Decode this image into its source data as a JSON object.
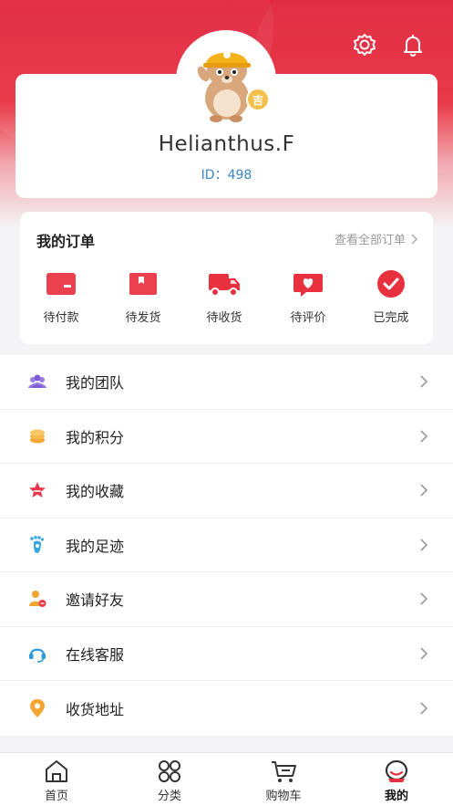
{
  "profile": {
    "username": "Helianthus.F",
    "user_id": "ID：498",
    "badge": "吉"
  },
  "header_icons": [
    "settings-icon",
    "bell-icon"
  ],
  "orders": {
    "title": "我的订单",
    "view_all": "查看全部订单",
    "items": [
      {
        "label": "待付款",
        "icon": "wallet-icon"
      },
      {
        "label": "待发货",
        "icon": "package-icon"
      },
      {
        "label": "待收货",
        "icon": "truck-icon"
      },
      {
        "label": "待评价",
        "icon": "review-icon"
      },
      {
        "label": "已完成",
        "icon": "check-icon"
      }
    ]
  },
  "menu": [
    {
      "label": "我的团队",
      "icon": "team-icon"
    },
    {
      "label": "我的积分",
      "icon": "points-icon"
    },
    {
      "label": "我的收藏",
      "icon": "star-icon"
    },
    {
      "label": "我的足迹",
      "icon": "footprint-icon"
    },
    {
      "label": "邀请好友",
      "icon": "invite-icon"
    },
    {
      "label": "在线客服",
      "icon": "headset-icon"
    },
    {
      "label": "收货地址",
      "icon": "location-icon"
    }
  ],
  "tabs": [
    {
      "label": "首页",
      "icon": "home-icon"
    },
    {
      "label": "分类",
      "icon": "category-icon"
    },
    {
      "label": "购物车",
      "icon": "cart-icon"
    },
    {
      "label": "我的",
      "icon": "profile-icon",
      "active": true
    }
  ],
  "colors": {
    "brand_red": "#e1233c",
    "id_blue": "#3d86c6"
  }
}
